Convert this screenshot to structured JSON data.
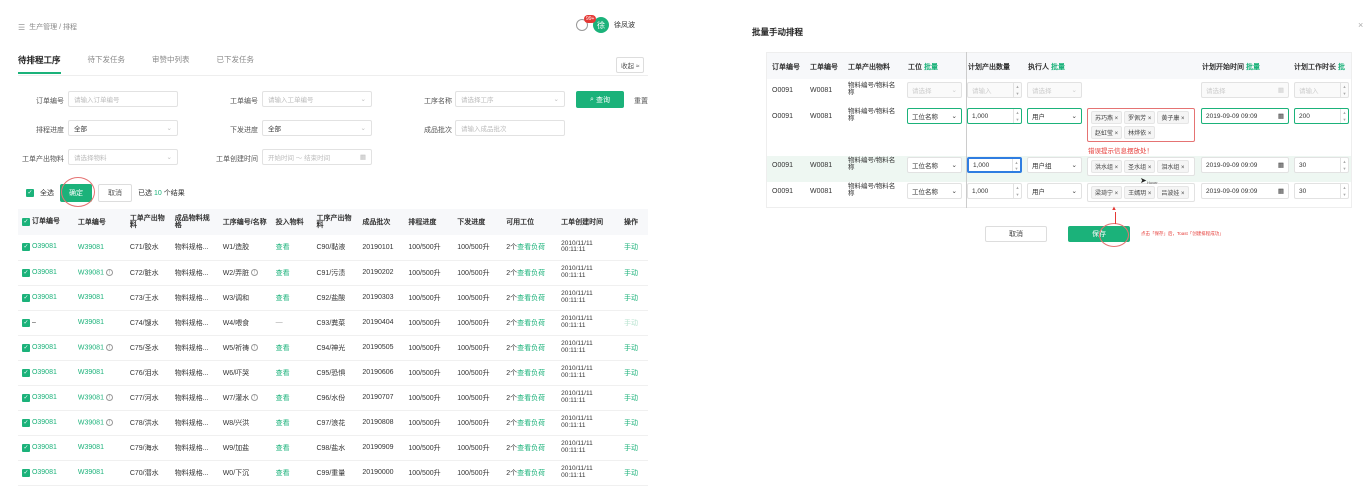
{
  "header": {
    "breadcrumb": "生产管理 / 排程",
    "notif_count": "99+",
    "avatar_char": "徐",
    "user_name": "徐凤波"
  },
  "tabs": [
    "待排程工序",
    "待下发任务",
    "审赞中列表",
    "已下发任务"
  ],
  "fold_label": "收起 ≈",
  "filters": {
    "order_no": {
      "label": "订单编号",
      "placeholder": "请输入订单编号"
    },
    "work_order_no": {
      "label": "工单编号",
      "placeholder": "请输入工单编号"
    },
    "process_name": {
      "label": "工序名称",
      "placeholder": "请选择工序"
    },
    "schedule_progress": {
      "label": "排程进度",
      "value": "全部"
    },
    "issue_progress": {
      "label": "下发进度",
      "value": "全部"
    },
    "product_batch": {
      "label": "成品批次",
      "placeholder": "请输入成品批次"
    },
    "product_material": {
      "label": "工单产出物料",
      "placeholder": "请选择物料"
    },
    "create_time": {
      "label": "工单创建时间",
      "placeholder": "开始时间 ～ 结束时间"
    },
    "search_label": "查询",
    "reset_label": "重置"
  },
  "selection": {
    "select_all": "全选",
    "confirm": "确定",
    "cancel": "取消",
    "selected_prefix": "已选",
    "selected_count": "10",
    "selected_suffix": "个结果"
  },
  "table": {
    "headers": [
      "订单编号",
      "工单编号",
      "工单产出物料",
      "成品物料规格",
      "工序编号/名称",
      "投入物料",
      "工序产出物料",
      "成品批次",
      "排程进度",
      "下发进度",
      "可用工位",
      "工单创建时间",
      "操作"
    ],
    "rows": [
      {
        "order": "O39081",
        "wo": "W39081",
        "wo_info": false,
        "mat": "C71/胶水",
        "spec": "物料规格...",
        "proc": "W1/造胶",
        "proc_info": false,
        "input": "查看",
        "out": "C90/黏液",
        "batch": "20190101",
        "sched": "100/500升",
        "issue": "100/500升",
        "avail": "2个",
        "avail_link": "查看负荷",
        "date": "2010/11/11",
        "time": "00:11:11",
        "op": "手动"
      },
      {
        "order": "O39081",
        "wo": "W39081",
        "wo_info": true,
        "mat": "C72/脏水",
        "spec": "物料规格...",
        "proc": "W2/弄脏",
        "proc_info": true,
        "input": "查看",
        "out": "C91/污渍",
        "batch": "20190202",
        "sched": "100/500升",
        "issue": "100/500升",
        "avail": "2个",
        "avail_link": "查看负荷",
        "date": "2010/11/11",
        "time": "00:11:11",
        "op": "手动"
      },
      {
        "order": "O39081",
        "wo": "W39081",
        "wo_info": false,
        "mat": "C73/王水",
        "spec": "物料规格...",
        "proc": "W3/调和",
        "proc_info": false,
        "input": "查看",
        "out": "C92/盐酸",
        "batch": "20190303",
        "sched": "100/500升",
        "issue": "100/500升",
        "avail": "2个",
        "avail_link": "查看负荷",
        "date": "2010/11/11",
        "time": "00:11:11",
        "op": "手动"
      },
      {
        "order": "–",
        "wo": "W39081",
        "wo_info": false,
        "mat": "C74/馊水",
        "spec": "物料规格...",
        "proc": "W4/喂食",
        "proc_info": false,
        "input": "—",
        "out": "C93/粪菜",
        "batch": "20190404",
        "sched": "100/500升",
        "issue": "100/500升",
        "avail": "2个",
        "avail_link": "查看负荷",
        "date": "2010/11/11",
        "time": "00:11:11",
        "op": "手动",
        "op_disabled": true
      },
      {
        "order": "O39081",
        "wo": "W39081",
        "wo_info": true,
        "mat": "C75/圣水",
        "spec": "物料规格...",
        "proc": "W5/祈祷",
        "proc_info": true,
        "input": "查看",
        "out": "C94/神光",
        "batch": "20190505",
        "sched": "100/500升",
        "issue": "100/500升",
        "avail": "2个",
        "avail_link": "查看负荷",
        "date": "2010/11/11",
        "time": "00:11:11",
        "op": "手动"
      },
      {
        "order": "O39081",
        "wo": "W39081",
        "wo_info": false,
        "mat": "C76/泪水",
        "spec": "物料规格...",
        "proc": "W6/吓哭",
        "proc_info": false,
        "input": "查看",
        "out": "C95/恐惧",
        "batch": "20190606",
        "sched": "100/500升",
        "issue": "100/500升",
        "avail": "2个",
        "avail_link": "查看负荷",
        "date": "2010/11/11",
        "time": "00:11:11",
        "op": "手动"
      },
      {
        "order": "O39081",
        "wo": "W39081",
        "wo_info": true,
        "mat": "C77/河水",
        "spec": "物料规格...",
        "proc": "W7/灌水",
        "proc_info": true,
        "input": "查看",
        "out": "C96/水份",
        "batch": "20190707",
        "sched": "100/500升",
        "issue": "100/500升",
        "avail": "2个",
        "avail_link": "查看负荷",
        "date": "2010/11/11",
        "time": "00:11:11",
        "op": "手动"
      },
      {
        "order": "O39081",
        "wo": "W39081",
        "wo_info": true,
        "mat": "C78/洪水",
        "spec": "物料规格...",
        "proc": "W8/兴洪",
        "proc_info": false,
        "input": "查看",
        "out": "C97/浪花",
        "batch": "20190808",
        "sched": "100/500升",
        "issue": "100/500升",
        "avail": "2个",
        "avail_link": "查看负荷",
        "date": "2010/11/11",
        "time": "00:11:11",
        "op": "手动"
      },
      {
        "order": "O39081",
        "wo": "W39081",
        "wo_info": false,
        "mat": "C79/海水",
        "spec": "物料规格...",
        "proc": "W9/加盐",
        "proc_info": false,
        "input": "查看",
        "out": "C98/盐水",
        "batch": "20190909",
        "sched": "100/500升",
        "issue": "100/500升",
        "avail": "2个",
        "avail_link": "查看负荷",
        "date": "2010/11/11",
        "time": "00:11:11",
        "op": "手动"
      },
      {
        "order": "O39081",
        "wo": "W39081",
        "wo_info": false,
        "mat": "C70/潜水",
        "spec": "物料规格...",
        "proc": "W0/下沉",
        "proc_info": false,
        "input": "查看",
        "out": "C99/重量",
        "batch": "20190000",
        "sched": "100/500升",
        "issue": "100/500升",
        "avail": "2个",
        "avail_link": "查看负荷",
        "date": "2010/11/11",
        "time": "00:11:11",
        "op": "手动"
      }
    ]
  },
  "modal": {
    "title": "批量手动排程",
    "close": "×",
    "headers": {
      "order": "订单编号",
      "wo": "工单编号",
      "mat": "工单产出物料",
      "station": "工位",
      "station_batch": "批量",
      "qty": "计划产出数量",
      "exec": "执行人",
      "exec_batch": "批量",
      "start": "计划开始时间",
      "start_batch": "批量",
      "duration": "计划工作时长",
      "duration_batch": "批"
    },
    "rows": [
      {
        "order": "O0091",
        "wo": "W0081",
        "mat": "物料编号/物料名称",
        "station": "请选择",
        "qty": "请输入",
        "exec": "请选择",
        "tags": [],
        "start": "请选择",
        "duration": "请输入"
      },
      {
        "order": "O0091",
        "wo": "W0081",
        "mat": "物料编号/物料名称",
        "station": "工位名称",
        "qty": "1,000",
        "exec": "用户",
        "tags": [
          "苏巧燕 ×",
          "罗佩芳 ×",
          "黄子康 ×",
          "赵虹莹 ×",
          "林烨依 ×"
        ],
        "start": "2019-09-09 09:09",
        "duration": "200"
      },
      {
        "order": "O0091",
        "wo": "W0081",
        "mat": "物料编号/物料名称",
        "station": "工位名称",
        "qty": "1,000",
        "exec": "用户组",
        "tags": [
          "洪水组 ×",
          "圣水组 ×",
          "泪水组 ×"
        ],
        "start": "2019-09-09 09:09",
        "duration": "30"
      },
      {
        "order": "O0091",
        "wo": "W0081",
        "mat": "物料编号/物料名称",
        "station": "工位名称",
        "qty": "1,000",
        "exec": "用户",
        "tags": [
          "梁琦宁 ×",
          "王嫣玥 ×",
          "吕波娃 ×"
        ],
        "start": "2019-09-09 09:09",
        "duration": "30"
      }
    ],
    "error_msg": "错误提示信息摆放处！",
    "hover_label": "Hover",
    "cancel": "取消",
    "save": "保存",
    "annotation": "点击「保存」后，Toast「创建排程成功」"
  }
}
